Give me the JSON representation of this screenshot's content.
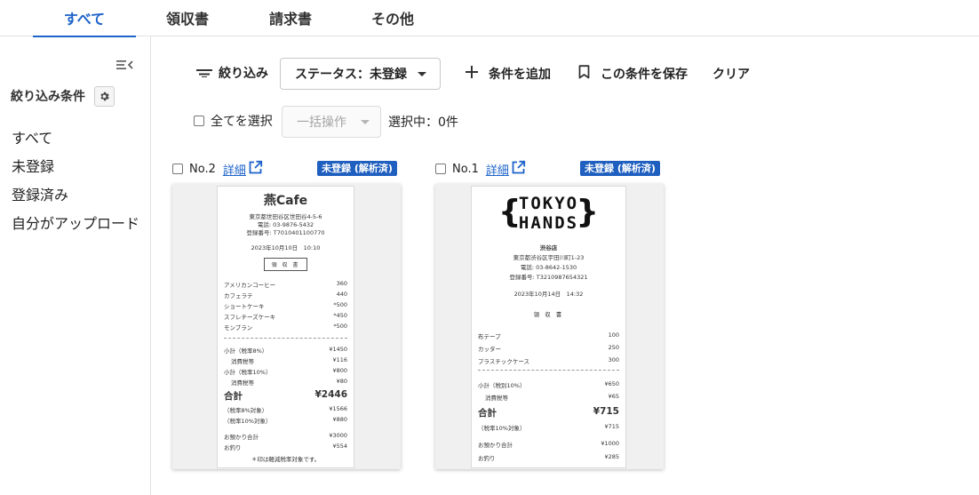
{
  "tabs": [
    {
      "label": "すべて",
      "active": true
    },
    {
      "label": "領収書",
      "active": false
    },
    {
      "label": "請求書",
      "active": false
    },
    {
      "label": "その他",
      "active": false
    }
  ],
  "sidebar": {
    "heading": "絞り込み条件",
    "items": [
      "すべて",
      "未登録",
      "登録済み",
      "自分がアップロード"
    ]
  },
  "toolbar": {
    "filter_label": "絞り込み",
    "status_select_value": "ステータス：未登録",
    "add_condition_label": "条件を追加",
    "save_condition_label": "この条件を保存",
    "clear_label": "クリア"
  },
  "bulk": {
    "select_all_label": "全てを選択",
    "bulk_action_placeholder": "一括操作",
    "selected_count": "選択中：0件"
  },
  "colors": {
    "accent": "#1d63c9",
    "badge": "#1f5fbf"
  },
  "cards": [
    {
      "number": "No.2",
      "detail_label": "詳細",
      "badge": "未登録 (解析済)",
      "receipt": {
        "store": "燕Cafe",
        "address": "東京都世田谷区世田谷4-5-6",
        "phone": "電話: 03-9876-5432",
        "reg": "登録番号: T7010401100770",
        "datetime": "2023年10月10日　10:10",
        "doc_title": "領 収 書",
        "items": [
          {
            "name": "アメリカンコーヒー",
            "price": "360"
          },
          {
            "name": "カフェラテ",
            "price": "440"
          },
          {
            "name": "ショートケーキ",
            "price": "*500"
          },
          {
            "name": "スフレチーズケーキ",
            "price": "*450"
          },
          {
            "name": "モンブラン",
            "price": "*500"
          }
        ],
        "subtotals": [
          {
            "name": "小計（税率8%）",
            "price": "¥1450",
            "sub": false
          },
          {
            "name": "消費税等",
            "price": "¥116",
            "sub": true
          },
          {
            "name": "小計（税率10%）",
            "price": "¥800",
            "sub": false
          },
          {
            "name": "消費税等",
            "price": "¥80",
            "sub": true
          }
        ],
        "total_label": "合計",
        "total": "¥2446",
        "targets": [
          {
            "name": "（税率8%対象）",
            "price": "¥1566"
          },
          {
            "name": "（税率10%対象）",
            "price": "¥880"
          }
        ],
        "paid": [
          {
            "name": "お預かり合計",
            "price": "¥3000"
          },
          {
            "name": "お釣り",
            "price": "¥554"
          }
        ],
        "note": "＊印は軽減税率対象です。"
      }
    },
    {
      "number": "No.1",
      "detail_label": "詳細",
      "badge": "未登録 (解析済)",
      "receipt": {
        "logo_line1": "TOKYO",
        "logo_line2": "HANDS",
        "branch": "渋谷店",
        "address": "東京都渋谷区宇田川町1-23",
        "phone": "電話: 03-8642-1530",
        "reg": "登録番号: T3210987654321",
        "datetime": "2023年10月14日　14:32",
        "doc_title": "領 収 書",
        "items": [
          {
            "name": "布テープ",
            "price": "100"
          },
          {
            "name": "カッター",
            "price": "250"
          },
          {
            "name": "プラスチックケース",
            "price": "300"
          }
        ],
        "subtotals": [
          {
            "name": "小計（税別10%）",
            "price": "¥650",
            "sub": false
          },
          {
            "name": "消費税等",
            "price": "¥65",
            "sub": true
          }
        ],
        "total_label": "合計",
        "total": "¥715",
        "targets": [
          {
            "name": "（税率10%対象）",
            "price": "¥715"
          }
        ],
        "paid": [
          {
            "name": "お預かり合計",
            "price": "¥1000"
          },
          {
            "name": "お釣り",
            "price": "¥285"
          }
        ]
      }
    }
  ]
}
